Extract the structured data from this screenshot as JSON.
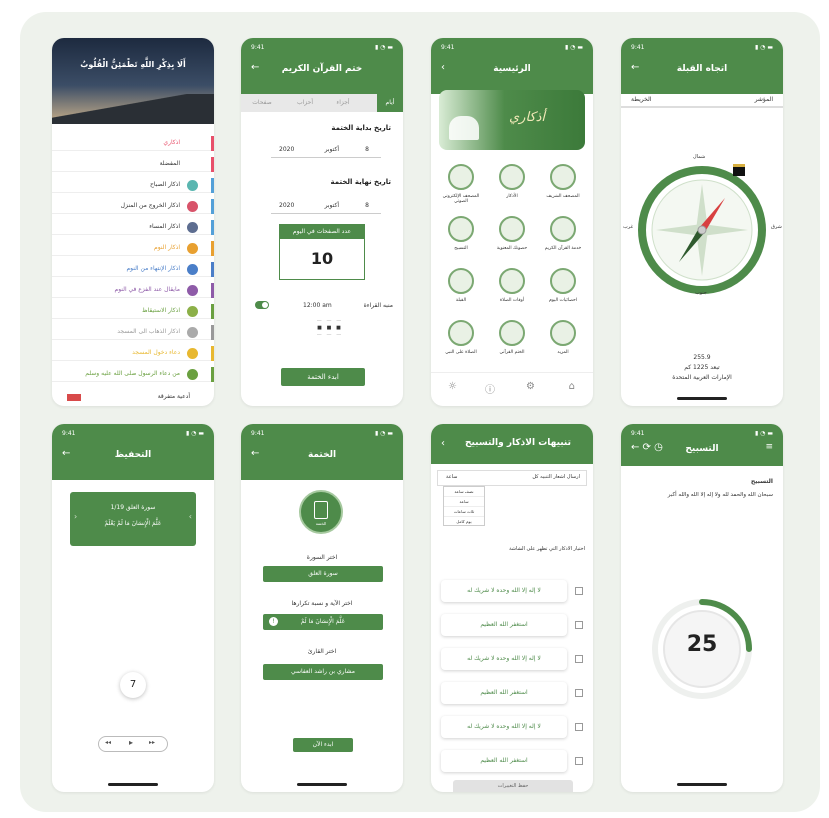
{
  "menu": {
    "header_title": "أَلَا بِذِكْرِ اللَّهِ تَطْمَئِنُّ الْقُلُوبُ",
    "items": [
      {
        "label": "اذكاري",
        "color": "#e8506a",
        "icon": "",
        "bar": "#e8506a"
      },
      {
        "label": "المفضلة",
        "color": "#333333",
        "icon": "",
        "bar": "#e8506a"
      },
      {
        "label": "اذكار الصباح",
        "color": "#333333",
        "icon": "sun-icon",
        "bar": "#53a0d8",
        "ic": "#5ab6b0"
      },
      {
        "label": "اذكار الخروج من المنزل",
        "color": "#333333",
        "icon": "door-icon",
        "bar": "#53a0d8",
        "ic": "#d8536a"
      },
      {
        "label": "اذكار المساء",
        "color": "#333333",
        "icon": "moon-icon",
        "bar": "#53a0d8",
        "ic": "#5d6d90"
      },
      {
        "label": "اذكار النوم",
        "color": "#e8a030",
        "icon": "bed-icon",
        "bar": "#e8a030",
        "ic": "#e8a030"
      },
      {
        "label": "اذكار الإنتهاء من النوم",
        "color": "#4a7ec8",
        "icon": "wake-icon",
        "bar": "#4a7ec8",
        "ic": "#4a7ec8"
      },
      {
        "label": "مايقال عند الفزع في النوم",
        "color": "#8e5ba8",
        "icon": "fear-icon",
        "bar": "#8e5ba8",
        "ic": "#8e5ba8"
      },
      {
        "label": "اذكار الاستيقاظ",
        "color": "#6aa040",
        "icon": "awake-icon",
        "bar": "#6aa040",
        "ic": "#8cb048"
      },
      {
        "label": "اذكار الذهاب الى المسجد",
        "color": "#999999",
        "icon": "mosque-icon",
        "bar": "#999999",
        "ic": "#aaaaaa"
      },
      {
        "label": "دعاء دخول المسجد",
        "color": "#e8b830",
        "icon": "enter-icon",
        "bar": "#e8b830",
        "ic": "#e8b830"
      },
      {
        "label": "من دعاء الرسول صلى الله عليه وسلم",
        "color": "#6aa040",
        "icon": "dua-icon",
        "bar": "#6aa040",
        "ic": "#6aa040"
      }
    ],
    "footer": "أدعية متفرقة"
  },
  "khatm": {
    "status_time": "9:41",
    "title": "ختم القرآن الكريم",
    "tabs": [
      "أيام",
      "أجزاء",
      "أحزاب",
      "صفحات"
    ],
    "start_label": "تاريخ بداية الختمة",
    "start": {
      "day": "8",
      "month": "أكتوبر",
      "year": "2020"
    },
    "end_label": "تاريخ نهاية الختمة",
    "end": {
      "day": "8",
      "month": "أكتوبر",
      "year": "2020"
    },
    "pages_label": "عدد الصفحات في اليوم",
    "pages_value": "10",
    "reminder_label": "منبه القراءة",
    "reminder_time": "12:00 am",
    "button": "ابدء الختمة"
  },
  "home": {
    "status_time": "9:41",
    "title": "الرئيسية",
    "banner_text": "أذكاري",
    "grid": [
      {
        "label": "المصحف الشريف",
        "icon": "quran-icon"
      },
      {
        "label": "الأذكار",
        "icon": "hands-icon"
      },
      {
        "label": "المصحف الإلكتروني الصوتي",
        "icon": "ebook-icon"
      },
      {
        "label": "خدمة القرآن الكريم",
        "icon": "headphones-icon"
      },
      {
        "label": "حصونك المعنوية",
        "icon": "person-icon"
      },
      {
        "label": "التسبيح",
        "icon": "beads-icon"
      },
      {
        "label": "احصائيات اليوم",
        "icon": "stats-icon"
      },
      {
        "label": "أوقات الصلاة",
        "icon": "mosque-icon"
      },
      {
        "label": "القبلة",
        "icon": "kaaba-icon"
      },
      {
        "label": "المزيد",
        "icon": "more-icon"
      },
      {
        "label": "الختم القرآني",
        "icon": "book-icon"
      },
      {
        "label": "الصلاة على النبي",
        "icon": "dome-icon"
      }
    ],
    "nav": [
      "home-icon",
      "settings-icon",
      "info-icon",
      "bulb-icon"
    ]
  },
  "qibla": {
    "status_time": "9:41",
    "title": "اتجاه القبلة",
    "tab_pointer": "المؤشر",
    "tab_map": "الخريطة",
    "n": "شمال",
    "s": "جنوب",
    "e": "شرق",
    "w": "غرب",
    "degree": "255.9",
    "distance": "تبعد 1225 كم",
    "country": "الإمارات العربية المتحدة"
  },
  "memorize": {
    "status_time": "9:41",
    "title": "التحفيظ",
    "surah_line": "سورة العلق 1/19",
    "ayah": "عَلَّمَ الْإِنسَانَ مَا لَمْ يَعْلَمْ",
    "repeat_count": "7"
  },
  "khatma": {
    "status_time": "9:41",
    "title": "الختمة",
    "book_label": "الختمة",
    "choose_surah_label": "اختر السورة",
    "surah_value": "سورة العلق",
    "choose_ayah_label": "اختر الآية و نسبة تكرارها",
    "ayah_value": "عَلَّمَ الْإِنسَانَ مَا لَمْ",
    "choose_reader_label": "اختر القارئ",
    "reader_value": "مشاري بن راشد العفاسي",
    "button": "ابدء الآن"
  },
  "alerts": {
    "title": "تنبيهات الاذكار والتسبيح",
    "every_label": "ارسال اشعار التنبيه كل",
    "every_value": "ساعة",
    "dropdown": [
      "نصف ساعة",
      "ساعة",
      "ثلاث ساعات",
      "يوم كامل"
    ],
    "choose_label": "اختيار الاذكار التي تظهر على الشاشة",
    "items": [
      "لا إله إلا الله وحده لا شريك له",
      "استغفر الله العظيم",
      "لا إله إلا الله وحده لا شريك له",
      "استغفر الله العظيم",
      "لا إله إلا الله وحده لا شريك له",
      "استغفر الله العظيم"
    ],
    "save": "حفظ التغييرات"
  },
  "tasbeeh": {
    "status_time": "9:41",
    "title": "التسبيح",
    "label": "التسبيح",
    "text": "سبحان الله والحمد لله ولا إله إلا الله والله أكبر",
    "count": "25",
    "progress": 0.25
  },
  "colors": {
    "primary": "#4e8b4a",
    "bg": "#eef2ec"
  }
}
